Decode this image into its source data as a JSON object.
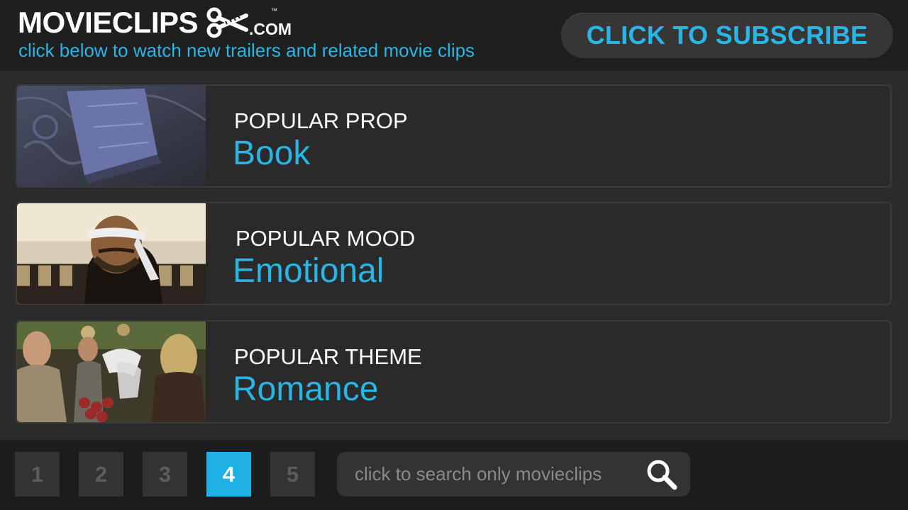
{
  "header": {
    "brand_name": "MOVIECLIPS",
    "brand_tm": "™",
    "brand_domain": ".COM",
    "brand_icon": "scissors-icon",
    "tagline": "click below to watch new trailers and related movie clips",
    "subscribe_label": "CLICK TO SUBSCRIBE"
  },
  "cards": [
    {
      "label": "POPULAR PROP",
      "value": "Book",
      "thumbnail": "book-still"
    },
    {
      "label": "POPULAR MOOD",
      "value": "Emotional",
      "thumbnail": "man-headband-still"
    },
    {
      "label": "POPULAR THEME",
      "value": "Romance",
      "thumbnail": "market-crowd-still"
    }
  ],
  "pagination": {
    "pages": [
      "1",
      "2",
      "3",
      "4",
      "5"
    ],
    "current": "4"
  },
  "search": {
    "placeholder": "click to search only movieclips",
    "icon": "search-icon"
  },
  "colors": {
    "accent": "#29b6e6",
    "background": "#2b2b2b",
    "header": "#1f1f1f",
    "active_page": "#1fb1e3"
  }
}
